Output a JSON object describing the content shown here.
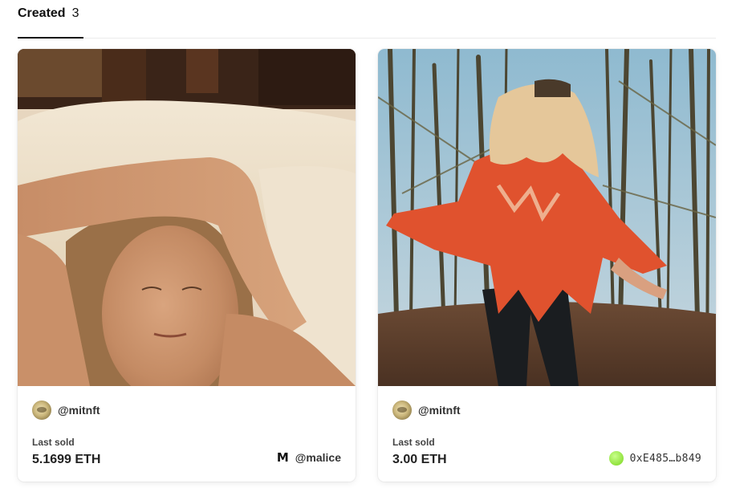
{
  "tabs": {
    "active_label": "Created",
    "active_count": "3"
  },
  "cards": [
    {
      "creator": "@mitnft",
      "last_sold_label": "Last sold",
      "price": "5.1699 ETH",
      "owner_icon": "M",
      "owner": "@malice"
    },
    {
      "creator": "@mitnft",
      "last_sold_label": "Last sold",
      "price": "3.00 ETH",
      "owner": "0xE485…b849"
    }
  ]
}
